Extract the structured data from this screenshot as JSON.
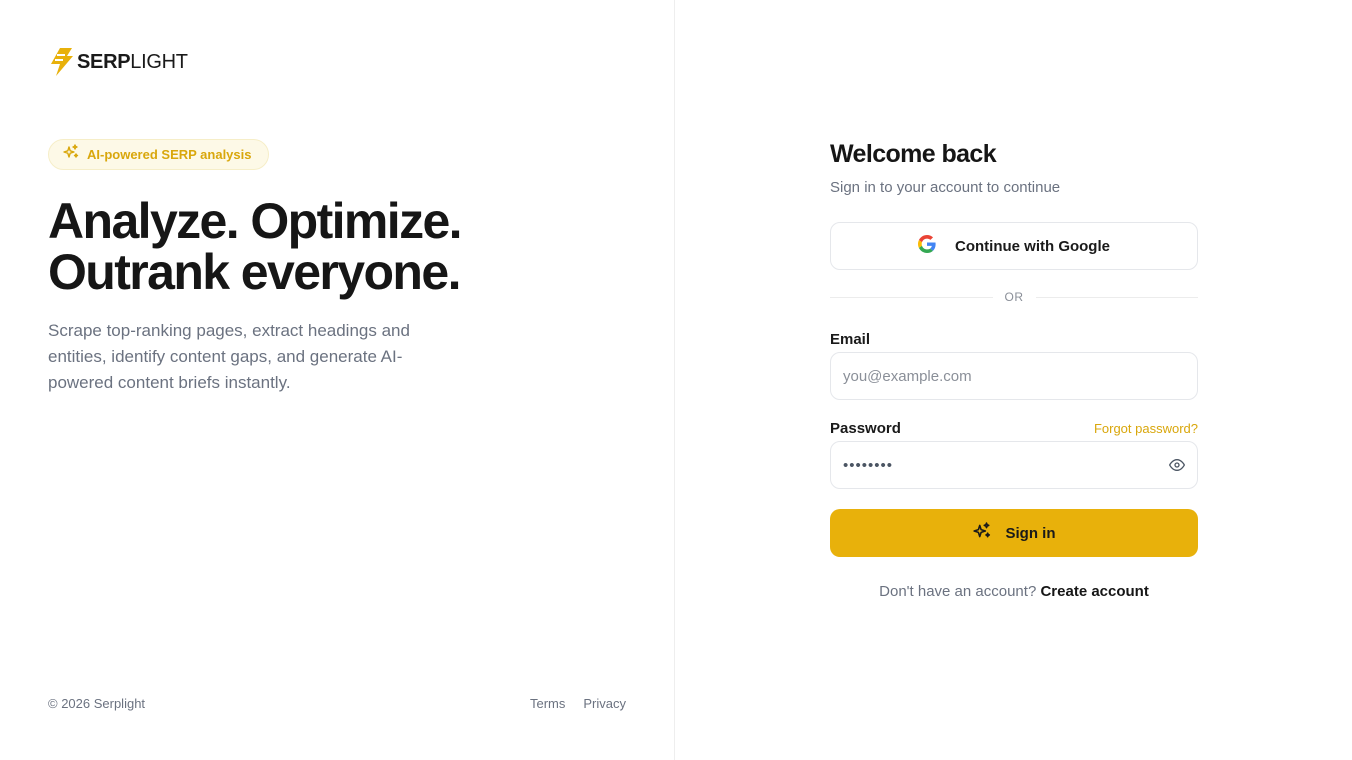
{
  "brand": {
    "name_bold": "SERP",
    "name_light": "LIGHT",
    "accent_color": "#E8B10B",
    "logo_icon": "lightning-bolt-icon"
  },
  "hero": {
    "badge_label": "AI-powered SERP analysis",
    "badge_icon": "sparkles-icon",
    "headline_line1": "Analyze. Optimize.",
    "headline_line2": "Outrank everyone.",
    "description": "Scrape top-ranking pages, extract headings and entities, identify content gaps, and generate AI-powered content briefs instantly."
  },
  "footer": {
    "copyright": "© 2026 Serplight",
    "terms": "Terms",
    "privacy": "Privacy"
  },
  "signin": {
    "title": "Welcome back",
    "subtitle": "Sign in to your account to continue",
    "google_button": "Continue with Google",
    "google_icon": "google-icon",
    "divider": "OR",
    "email_label": "Email",
    "email_placeholder": "you@example.com",
    "password_label": "Password",
    "forgot_password": "Forgot password?",
    "password_value": "••••••••",
    "eye_icon": "eye-icon",
    "submit_button": "Sign in",
    "no_account_text": "Don't have an account?",
    "create_account": "Create account"
  }
}
